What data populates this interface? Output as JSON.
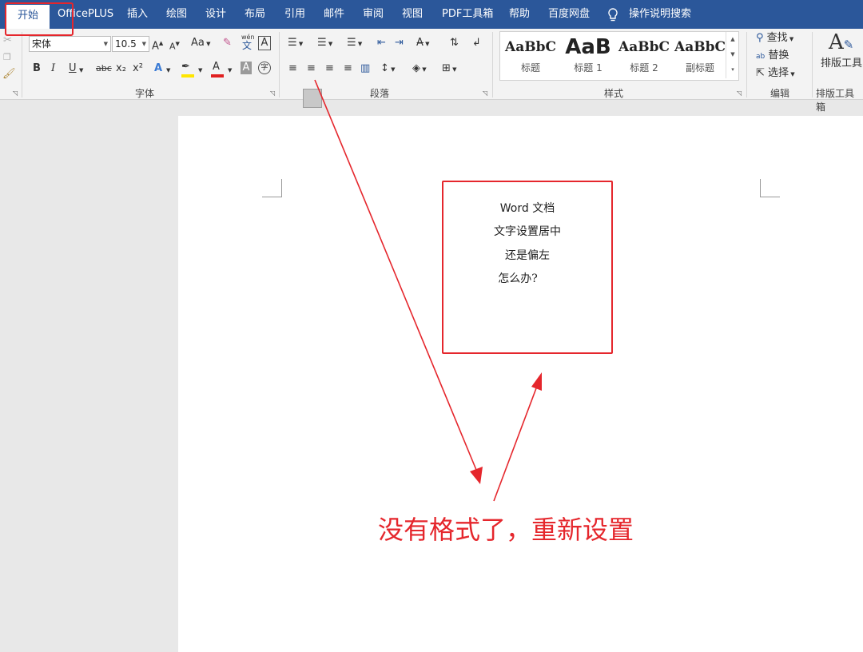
{
  "tabs": [
    "开始",
    "OfficePLUS",
    "插入",
    "绘图",
    "设计",
    "布局",
    "引用",
    "邮件",
    "审阅",
    "视图",
    "PDF工具箱",
    "帮助",
    "百度网盘"
  ],
  "tell_me": "操作说明搜索",
  "font": {
    "name": "宋体",
    "size": "10.5",
    "bold": "B",
    "italic": "I",
    "underline": "U",
    "strike": "abc",
    "sub": "x₂",
    "sup": "x²",
    "grow": "A",
    "shrink": "A",
    "case": "Aa",
    "phonetic": "wén",
    "phonetic_char": "文",
    "group_label": "字体"
  },
  "paragraph": {
    "group_label": "段落"
  },
  "styles": {
    "group_label": "样式",
    "items": [
      {
        "preview": "AaBbC",
        "name": "标题"
      },
      {
        "preview": "AaB",
        "name": "标题 1"
      },
      {
        "preview": "AaBbC",
        "name": "标题 2"
      },
      {
        "preview": "AaBbC",
        "name": "副标题"
      }
    ]
  },
  "editing": {
    "find": "查找",
    "replace": "替换",
    "select": "选择",
    "group_label": "编辑"
  },
  "typeset": {
    "button": "排版工具",
    "group_label": "排版工具箱"
  },
  "document": {
    "lines": [
      "Word 文档",
      "文字设置居中",
      "还是偏左",
      "怎么办?"
    ]
  },
  "annotation": "没有格式了，重新设置",
  "colors": {
    "ribbon_blue": "#2b579a",
    "annotation_red": "#e5262c",
    "highlight_yellow": "#ffe600",
    "font_red": "#e02020"
  }
}
